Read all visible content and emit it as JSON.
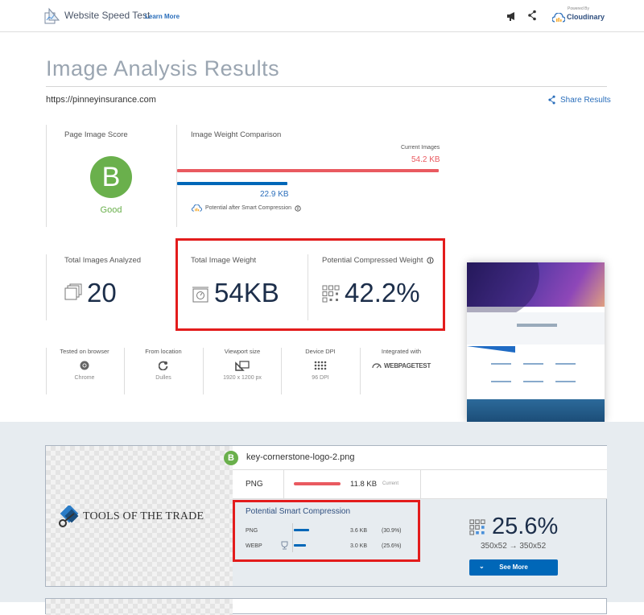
{
  "header": {
    "app_title": "Website Speed Test",
    "learn_more": "Learn More",
    "powered_by": "Powered By",
    "brand": "Cloudinary"
  },
  "page": {
    "title": "Image Analysis Results",
    "url": "https://pinneyinsurance.com",
    "share_results": "Share Results"
  },
  "score": {
    "label": "Page Image Score",
    "grade": "B",
    "grade_text": "Good",
    "color": "#6ab04c"
  },
  "weight_comparison": {
    "label": "Image Weight Comparison",
    "current_label": "Current Images",
    "current_value": "54.2 KB",
    "current_kb": 54.2,
    "compressed_value": "22.9 KB",
    "compressed_kb": 22.9,
    "compressed_label": "Potential after Smart Compression",
    "current_color": "#e95a60",
    "compressed_color": "#0067b8"
  },
  "stats": {
    "total_images_label": "Total Images Analyzed",
    "total_images_value": "20",
    "total_weight_label": "Total Image Weight",
    "total_weight_value": "54KB",
    "compressed_weight_label": "Potential Compressed Weight",
    "compressed_weight_value": "42.2%"
  },
  "test_info": [
    {
      "title": "Tested on browser",
      "value": "Chrome",
      "icon": "chrome-icon"
    },
    {
      "title": "From location",
      "value": "Dulles",
      "icon": "location-icon"
    },
    {
      "title": "Viewport size",
      "value": "1920 x 1200 px",
      "icon": "viewport-icon"
    },
    {
      "title": "Device DPI",
      "value": "96 DPI",
      "icon": "dpi-icon"
    },
    {
      "title": "Integrated with",
      "value": "WEBPAGETEST",
      "icon": "webpagetest-logo"
    }
  ],
  "image_card": {
    "grade": "B",
    "filename": "key-cornerstone-logo-2.png",
    "preview_text": "TOOLS OF THE TRADE",
    "format": "PNG",
    "size": "11.8 KB",
    "size_tag": "Current",
    "compression_title": "Potential Smart Compression",
    "options": [
      {
        "format": "PNG",
        "size": "3.6 KB",
        "percent": "(30.9%)",
        "fraction": 0.309,
        "best": false
      },
      {
        "format": "WEBP",
        "size": "3.0 KB",
        "percent": "(25.6%)",
        "fraction": 0.256,
        "best": true
      }
    ],
    "best_percent": "25.6%",
    "dimensions": "350x52 → 350x52",
    "see_more": "See More"
  }
}
